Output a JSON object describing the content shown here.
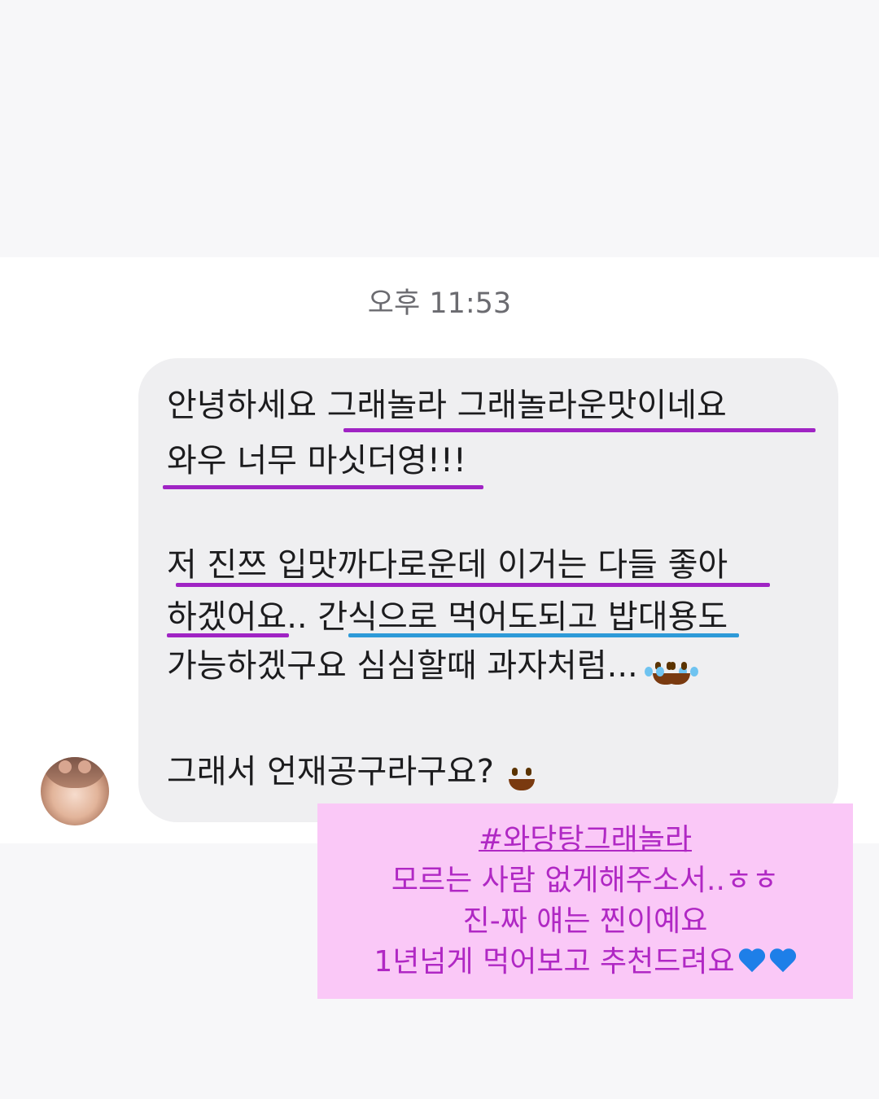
{
  "timestamp": "오후 11:53",
  "message": {
    "line1": "안녕하세요 그래놀라 그래놀라운맛이네요",
    "line2": "와우 너무 마싯더영!!!",
    "line3": "저 진쯔 입맛까다로운데 이거는 다들 좋아",
    "line4": "하겠어요.. 간식으로 먹어도되고 밥대용도",
    "line5": "가능하겠구요 심심할때 과자처럼...",
    "line6": "그래서 언재공구라구요?"
  },
  "emojis": {
    "rofl": "rolling-on-floor-laughing-icon",
    "grin": "grinning-face-icon",
    "heart": "blue-heart-icon"
  },
  "note": {
    "hashtag": "#와당탕그래놀라",
    "line2": "모르는 사람 없게해주소서..ㅎㅎ",
    "line3": "진-짜 얘는 찐이예요",
    "line4": "1년넘게 먹어보고 추천드려요"
  },
  "colors": {
    "underline_purple": "#a024c4",
    "underline_blue": "#2e9ad8",
    "note_bg": "#fac8f7",
    "note_text": "#b028c4",
    "bubble_bg": "#efeff1"
  }
}
